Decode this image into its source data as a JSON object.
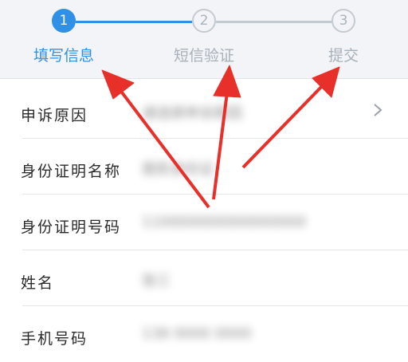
{
  "stepper": {
    "steps": [
      {
        "number": "1",
        "label": "填写信息",
        "state": "active"
      },
      {
        "number": "2",
        "label": "短信验证",
        "state": "inactive"
      },
      {
        "number": "3",
        "label": "提交",
        "state": "inactive"
      }
    ]
  },
  "form": {
    "rows": [
      {
        "label": "申诉原因",
        "value": "请选择申诉原因",
        "has_chevron": true
      },
      {
        "label": "身份证明名称",
        "value": "居民身份证",
        "has_chevron": false
      },
      {
        "label": "身份证明号码",
        "value": "110000000000000000",
        "has_chevron": false
      },
      {
        "label": "姓名",
        "value": "张三",
        "has_chevron": false
      },
      {
        "label": "手机号码",
        "value": "138 0000 0000",
        "has_chevron": false
      }
    ]
  },
  "colors": {
    "accent": "#2f90e6",
    "inactive": "#c3cad2",
    "annotation_arrow": "#e8302a"
  },
  "icons": {
    "chevron": "chevron-right-icon",
    "annotation": "red-arrow"
  }
}
